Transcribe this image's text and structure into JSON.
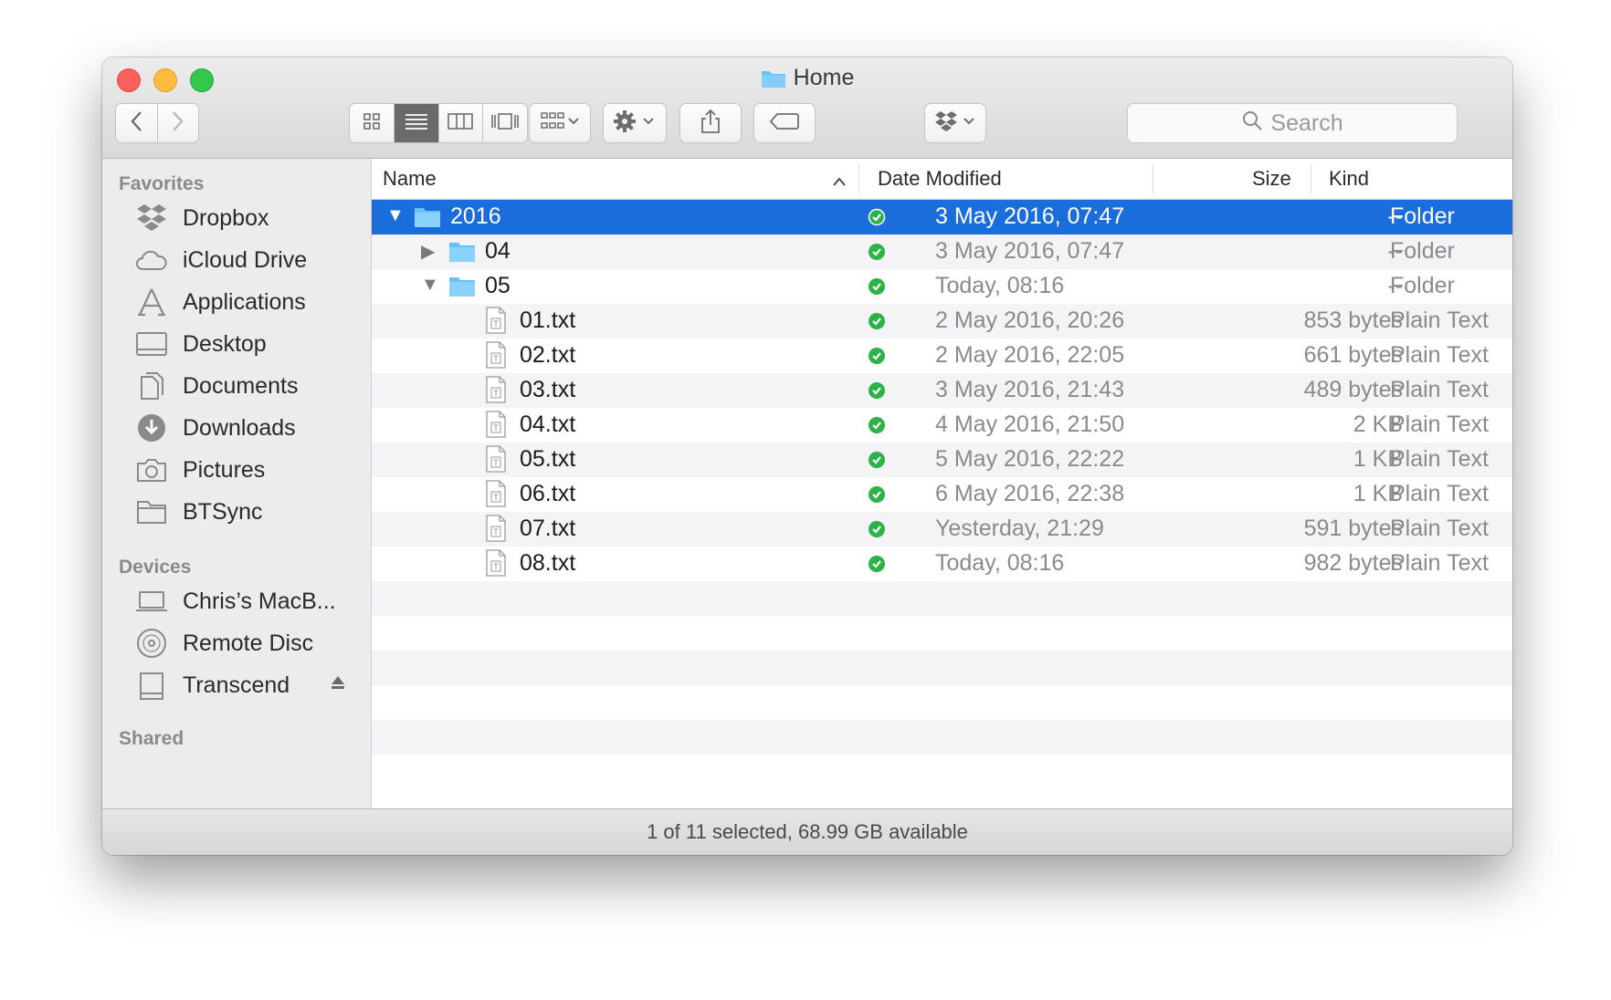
{
  "window": {
    "title": "Home"
  },
  "toolbar": {
    "back_icon": "chevron-left-icon",
    "forward_icon": "chevron-right-icon",
    "view_modes": [
      "icon-view-icon",
      "list-view-icon",
      "column-view-icon",
      "coverflow-view-icon"
    ],
    "active_view": "list",
    "arrange_icon": "arrange-icon",
    "action_icon": "gear-icon",
    "share_icon": "share-icon",
    "tags_icon": "tag-icon",
    "dropbox_icon": "dropbox-icon",
    "search_placeholder": "Search"
  },
  "sidebar": {
    "favorites_heading": "Favorites",
    "favorites": [
      {
        "label": "Dropbox",
        "icon": "dropbox-icon"
      },
      {
        "label": "iCloud Drive",
        "icon": "cloud-icon"
      },
      {
        "label": "Applications",
        "icon": "applications-icon"
      },
      {
        "label": "Desktop",
        "icon": "desktop-icon"
      },
      {
        "label": "Documents",
        "icon": "documents-icon"
      },
      {
        "label": "Downloads",
        "icon": "downloads-icon"
      },
      {
        "label": "Pictures",
        "icon": "camera-icon"
      },
      {
        "label": "BTSync",
        "icon": "folder-icon"
      }
    ],
    "devices_heading": "Devices",
    "devices": [
      {
        "label": "Chris’s MacB...",
        "icon": "laptop-icon"
      },
      {
        "label": "Remote Disc",
        "icon": "disc-icon"
      },
      {
        "label": "Transcend",
        "icon": "drive-icon"
      }
    ],
    "shared_heading": "Shared"
  },
  "columns": {
    "name": "Name",
    "date": "Date Modified",
    "size": "Size",
    "kind": "Kind"
  },
  "files": [
    {
      "name": "2016",
      "type": "folder",
      "level": 0,
      "disclosure": "expanded",
      "date": "3 May 2016, 07:47",
      "size": "--",
      "kind": "Folder",
      "selected": true
    },
    {
      "name": "04",
      "type": "folder",
      "level": 1,
      "disclosure": "collapsed",
      "date": "3 May 2016, 07:47",
      "size": "--",
      "kind": "Folder"
    },
    {
      "name": "05",
      "type": "folder",
      "level": 1,
      "disclosure": "expanded",
      "date": "Today, 08:16",
      "size": "--",
      "kind": "Folder"
    },
    {
      "name": "01.txt",
      "type": "file",
      "level": 2,
      "date": "2 May 2016, 20:26",
      "size": "853 bytes",
      "kind": "Plain Text"
    },
    {
      "name": "02.txt",
      "type": "file",
      "level": 2,
      "date": "2 May 2016, 22:05",
      "size": "661 bytes",
      "kind": "Plain Text"
    },
    {
      "name": "03.txt",
      "type": "file",
      "level": 2,
      "date": "3 May 2016, 21:43",
      "size": "489 bytes",
      "kind": "Plain Text"
    },
    {
      "name": "04.txt",
      "type": "file",
      "level": 2,
      "date": "4 May 2016, 21:50",
      "size": "2 KB",
      "kind": "Plain Text"
    },
    {
      "name": "05.txt",
      "type": "file",
      "level": 2,
      "date": "5 May 2016, 22:22",
      "size": "1 KB",
      "kind": "Plain Text"
    },
    {
      "name": "06.txt",
      "type": "file",
      "level": 2,
      "date": "6 May 2016, 22:38",
      "size": "1 KB",
      "kind": "Plain Text"
    },
    {
      "name": "07.txt",
      "type": "file",
      "level": 2,
      "date": "Yesterday, 21:29",
      "size": "591 bytes",
      "kind": "Plain Text"
    },
    {
      "name": "08.txt",
      "type": "file",
      "level": 2,
      "date": "Today, 08:16",
      "size": "982 bytes",
      "kind": "Plain Text"
    }
  ],
  "status": {
    "text": "1 of 11 selected, 68.99 GB available"
  },
  "colors": {
    "selection": "#1a6ddb",
    "folder": "#68c1f7",
    "sync_ok": "#2db24a"
  }
}
